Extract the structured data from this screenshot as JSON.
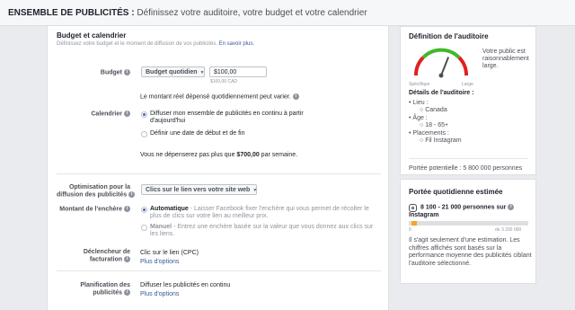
{
  "header": {
    "title_bold": "ENSEMBLE DE PUBLICITÉS :",
    "title_rest": " Définissez votre auditoire, votre budget et votre calendrier"
  },
  "budget_section": {
    "title": "Budget et calendrier",
    "subtitle": "Définissez votre budget et le moment de diffusion de vos publicités.",
    "learn_more": "En savoir plus.",
    "budget_label": "Budget",
    "budget_type": "Budget quotidien",
    "budget_value": "$100,00",
    "budget_currency_note": "$100,00 CAD",
    "actual_spend_note": "Le montant réel dépensé quotidiennement peut varier.",
    "schedule_label": "Calendrier",
    "schedule_option1_line1": "Diffuser mon ensemble de publicités en continu à partir",
    "schedule_option1_line2": "d'aujourd'hui",
    "schedule_option2": "Définir une date de début et de fin",
    "weekly_note_pre": "Vous ne dépenserez pas plus que ",
    "weekly_amount": "$700,00",
    "weekly_note_post": " par semaine."
  },
  "optimization": {
    "label_line1": "Optimisation pour la",
    "label_line2": "diffusion des publicités",
    "value": "Clics sur le lien vers votre site web",
    "bid_label": "Montant de l'enchère",
    "bid_auto_title": "Automatique",
    "bid_auto_desc_line1": " - Laisser Facebook fixer l'enchère qui vous permet de récolter le",
    "bid_auto_desc_line2": "plus de clics sur votre lien au meilleur prix.",
    "bid_manual_title": "Manuel",
    "bid_manual_desc_line1": " - Entrez une enchère basée sur la valeur que vous donnez aux clics sur",
    "bid_manual_desc_line2": "les liens.",
    "billing_label_line1": "Déclencheur de",
    "billing_label_line2": "facturation",
    "billing_value": "Clic sur le lien (CPC)",
    "billing_more": "Plus d'options",
    "schedule_label_line1": "Planification des",
    "schedule_label_line2": "publicités",
    "schedule_value": "Diffuser les publicités en continu",
    "schedule_more": "Plus d'options"
  },
  "audience": {
    "title": "Définition de l'auditoire",
    "gauge_left": "Spécifique",
    "gauge_right": "Large",
    "gauge_level": 0.62,
    "status_line1": "Votre public est",
    "status_line2": "raisonnablement",
    "status_line3": "large.",
    "details_title": "Détails de l'auditoire :",
    "location_label": "Lieu :",
    "location_value": "Canada",
    "age_label": "Âge :",
    "age_value": "18 - 65+",
    "placements_label": "Placements :",
    "placements_value": "Fil Instagram",
    "potential_reach": "Portée potentielle : 5 800 000 personnes"
  },
  "daily_reach": {
    "title": "Portée quotidienne estimée",
    "range_line1": "8 100 - 21 000 personnes sur",
    "range_line2": "Instagram",
    "bar_min": "0",
    "bar_max": "de 3 200 000",
    "bar_fill_low": 0.025,
    "bar_fill_high": 0.066,
    "note_line1": "Il s'agit seulement d'une estimation. Les",
    "note_line2": "chiffres affichés sont basés sur la",
    "note_line3": "performance moyenne des publicités ciblant",
    "note_line4": "l'auditoire sélectionné."
  },
  "colors": {
    "accent": "#4267b2",
    "link": "#365899",
    "bar_fill": "#f5a623"
  }
}
